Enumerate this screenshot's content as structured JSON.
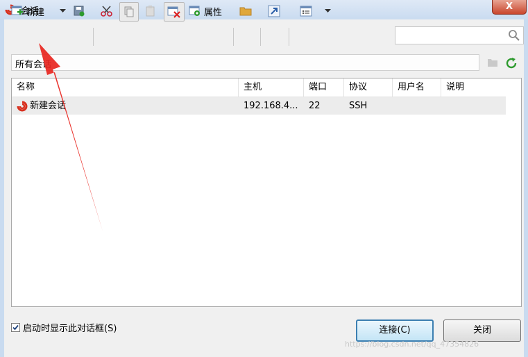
{
  "window": {
    "title": "会话",
    "close_label": "X"
  },
  "toolbar": {
    "new_label": "新建",
    "properties_label": "属性"
  },
  "search": {
    "value": "",
    "placeholder": ""
  },
  "path": "所有会话",
  "columns": [
    "名称",
    "主机",
    "端口",
    "协议",
    "用户名",
    "说明"
  ],
  "sessions": [
    {
      "name": "新建会话",
      "host": "192.168.4...",
      "port": "22",
      "protocol": "SSH",
      "user": "",
      "desc": ""
    }
  ],
  "footer": {
    "startup_checked": true,
    "startup_label": "启动时显示此对话框(S)",
    "connect_label": "连接(C)",
    "close_label": "关闭"
  },
  "watermark": "https://blog.csdn.net/qq_47354826",
  "colors": {
    "annotation_arrow": "#e8261f",
    "accent_green": "#2d9a2d",
    "app_icon": "#d8301f"
  }
}
